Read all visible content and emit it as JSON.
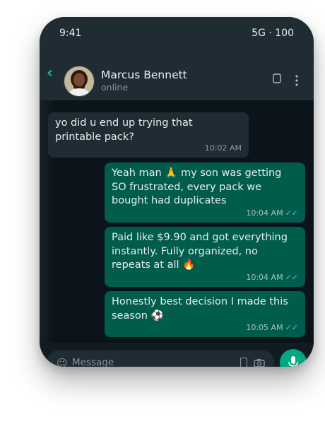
{
  "status_bar": {
    "time": "9:41",
    "network": "5G · 100"
  },
  "header": {
    "back_glyph": "‹",
    "contact_name": "Marcus Bennett",
    "contact_status": "online",
    "icons": [
      "back-icon",
      "avatar",
      "phone-icon",
      "menu-dots-icon"
    ]
  },
  "messages": [
    {
      "direction": "incoming",
      "text": "yo did u end up trying that printable pack?",
      "time": "10:02 AM",
      "ticks": ""
    },
    {
      "direction": "outgoing",
      "text": "Yeah man 🙏 my son was getting SO frustrated, every pack we bought had duplicates",
      "time": "10:04 AM",
      "ticks": "✓✓"
    },
    {
      "direction": "outgoing",
      "text": "Paid like $9.90 and got everything instantly. Fully organized, no repeats at all 🔥",
      "time": "10:04 AM",
      "ticks": "✓✓"
    },
    {
      "direction": "outgoing",
      "text": "Honestly best decision I made this season ⚽",
      "time": "10:05 AM",
      "ticks": "✓✓"
    }
  ],
  "composer": {
    "emoji_glyph": "☺",
    "placeholder": "Message",
    "icons": [
      "emoji-icon",
      "attach-icon",
      "camera-icon",
      "mic-icon"
    ]
  },
  "colors": {
    "header_bg": "#1f2c34",
    "chat_bg": "#0b141a",
    "incoming_bubble": "#202c33",
    "outgoing_bubble": "#005c4b",
    "accent": "#00a884",
    "read_ticks": "#53bdeb"
  }
}
